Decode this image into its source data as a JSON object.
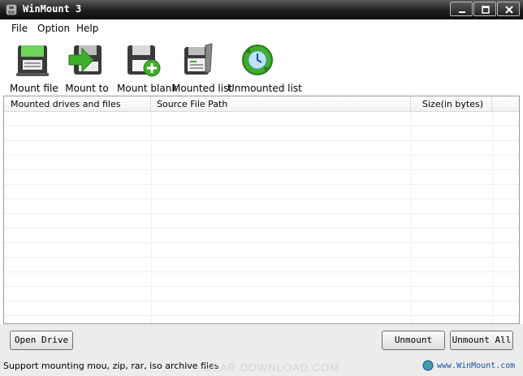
{
  "window": {
    "title": "WinMount 3",
    "controls": [
      "minimize-icon",
      "maximize-icon",
      "close-icon"
    ]
  },
  "menu": {
    "items": [
      "File",
      "Option",
      "Help"
    ]
  },
  "toolbar": {
    "buttons": [
      {
        "label": "Mount file",
        "icon": "mount-file-icon"
      },
      {
        "label": "Mount to",
        "icon": "mount-to-icon"
      },
      {
        "label": "Mount blank",
        "icon": "mount-blank-icon"
      },
      {
        "label": "Mounted list",
        "icon": "mounted-list-icon"
      },
      {
        "label": "Unmounted list",
        "icon": "unmounted-list-icon"
      }
    ]
  },
  "table": {
    "columns": [
      "Mounted drives and files",
      "Source File Path",
      "Size(in bytes)"
    ],
    "rows": []
  },
  "buttons": {
    "open_drive": "Open Drive",
    "unmount": "Unmount",
    "unmount_all": "Unmount All"
  },
  "status": {
    "text": "Support mounting mou, zip, rar, iso archive files",
    "site": "www.WinMount.com",
    "watermark": "GEAR DOWNLOAD.COM"
  },
  "colors": {
    "titlebar": "#1e1e1e",
    "link": "#1a4fa0",
    "accent_green": "#3fae2a"
  }
}
